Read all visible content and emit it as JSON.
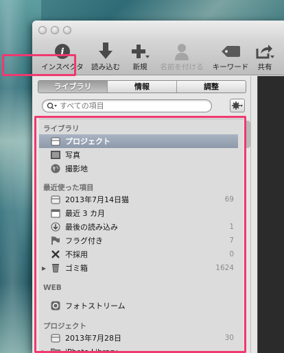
{
  "toolbar": {
    "inspector": "インスペクタ",
    "import": "読み込む",
    "new": "新規",
    "name": "名前を付ける",
    "keyword": "キーワード",
    "share": "共有"
  },
  "tabs": [
    "ライブラリ",
    "情報",
    "調整"
  ],
  "search": {
    "placeholder": "すべての項目"
  },
  "sections": {
    "library": "ライブラリ",
    "recent": "最近使った項目",
    "web": "WEB",
    "projects": "プロジェクト"
  },
  "library_items": [
    {
      "label": "プロジェクト",
      "icon": "project-icon",
      "selected": true
    },
    {
      "label": "写真",
      "icon": "photo-icon"
    },
    {
      "label": "撮影地",
      "icon": "globe-icon"
    }
  ],
  "recent_items": [
    {
      "label": "2013年7月14日猫",
      "count": "69",
      "icon": "project-icon"
    },
    {
      "label": "最近 3 カ月",
      "count": "",
      "icon": "calendar-icon"
    },
    {
      "label": "最後の読み込み",
      "count": "1",
      "icon": "import-icon"
    },
    {
      "label": "フラグ付き",
      "count": "7",
      "icon": "flag-icon"
    },
    {
      "label": "不採用",
      "count": "0",
      "icon": "x-icon"
    },
    {
      "label": "ゴミ箱",
      "count": "1624",
      "icon": "trash-icon"
    }
  ],
  "web_items": [
    {
      "label": "フォトストリーム",
      "icon": "photostream-icon"
    }
  ],
  "project_items": [
    {
      "label": "2013年7月28日",
      "count": "30",
      "icon": "project-icon"
    },
    {
      "label": "iPhoto Library",
      "count": "",
      "icon": "folder-icon"
    }
  ],
  "colors": {
    "highlight": "#f0386f",
    "selection": "#8d99aa"
  }
}
